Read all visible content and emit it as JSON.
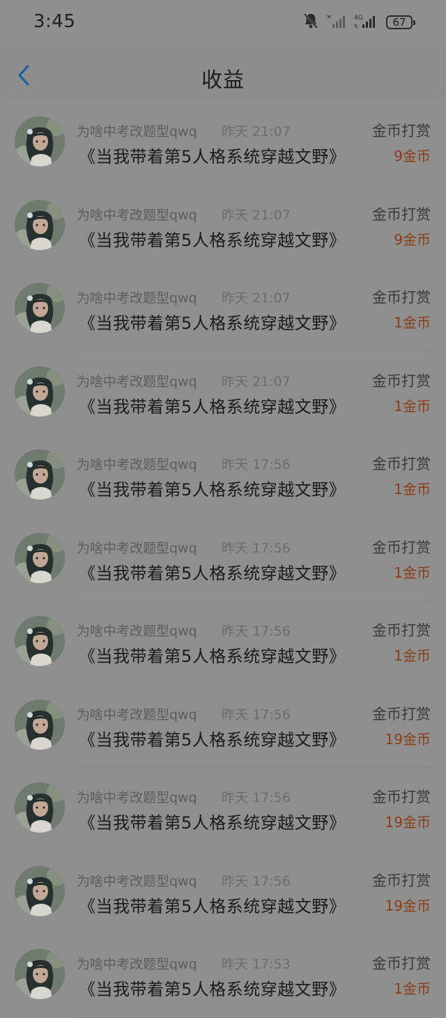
{
  "status_bar": {
    "time": "3:45",
    "network": "4G",
    "battery": "67",
    "icons": [
      "bell-muted-icon",
      "signal-no-service-icon",
      "signal-4g-icon",
      "battery-icon"
    ]
  },
  "header": {
    "title": "收益",
    "back_icon": "chevron-left-icon"
  },
  "colors": {
    "accent_back": "#1f5f9e",
    "amount": "#8a3d14",
    "background": "#8f8f8f"
  },
  "items": [
    {
      "name": "为啥中考改题型qwq",
      "time": "昨天 21:07",
      "type": "金币打赏",
      "book": "《当我带着第5人格系统穿越文野》",
      "amount": "9金币"
    },
    {
      "name": "为啥中考改题型qwq",
      "time": "昨天 21:07",
      "type": "金币打赏",
      "book": "《当我带着第5人格系统穿越文野》",
      "amount": "9金币"
    },
    {
      "name": "为啥中考改题型qwq",
      "time": "昨天 21:07",
      "type": "金币打赏",
      "book": "《当我带着第5人格系统穿越文野》",
      "amount": "1金币"
    },
    {
      "name": "为啥中考改题型qwq",
      "time": "昨天 21:07",
      "type": "金币打赏",
      "book": "《当我带着第5人格系统穿越文野》",
      "amount": "1金币"
    },
    {
      "name": "为啥中考改题型qwq",
      "time": "昨天 17:56",
      "type": "金币打赏",
      "book": "《当我带着第5人格系统穿越文野》",
      "amount": "1金币"
    },
    {
      "name": "为啥中考改题型qwq",
      "time": "昨天 17:56",
      "type": "金币打赏",
      "book": "《当我带着第5人格系统穿越文野》",
      "amount": "1金币"
    },
    {
      "name": "为啥中考改题型qwq",
      "time": "昨天 17:56",
      "type": "金币打赏",
      "book": "《当我带着第5人格系统穿越文野》",
      "amount": "1金币"
    },
    {
      "name": "为啥中考改题型qwq",
      "time": "昨天 17:56",
      "type": "金币打赏",
      "book": "《当我带着第5人格系统穿越文野》",
      "amount": "19金币"
    },
    {
      "name": "为啥中考改题型qwq",
      "time": "昨天 17:56",
      "type": "金币打赏",
      "book": "《当我带着第5人格系统穿越文野》",
      "amount": "19金币"
    },
    {
      "name": "为啥中考改题型qwq",
      "time": "昨天 17:56",
      "type": "金币打赏",
      "book": "《当我带着第5人格系统穿越文野》",
      "amount": "19金币"
    },
    {
      "name": "为啥中考改题型qwq",
      "time": "昨天 17:53",
      "type": "金币打赏",
      "book": "《当我带着第5人格系统穿越文野》",
      "amount": "1金币"
    }
  ]
}
